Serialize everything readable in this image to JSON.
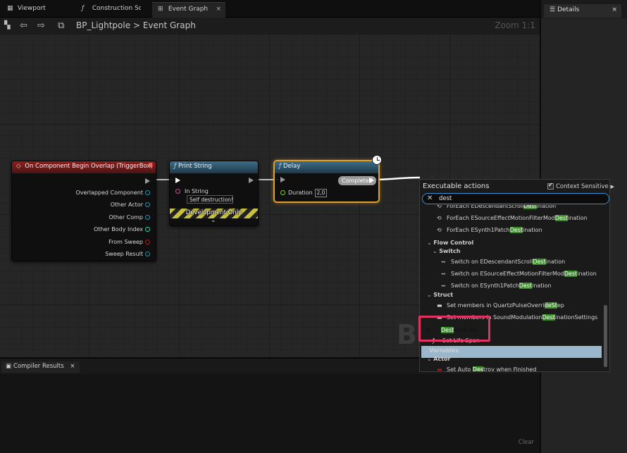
{
  "tabs": [
    {
      "label": "Viewport",
      "icon": "viewport-grid-icon"
    },
    {
      "label": "Construction Scri",
      "icon": "function-icon"
    },
    {
      "label": "Event Graph",
      "icon": "event-graph-icon",
      "close": "×"
    }
  ],
  "toolbar": {
    "blueprint_name": "BP_Lightpole",
    "separator": ">",
    "graph_name": "Event Graph",
    "zoom": "Zoom 1:1"
  },
  "graph": {
    "watermark": "BL",
    "nodes": {
      "begin_overlap": {
        "title": "On Component Begin Overlap (TriggerBox)",
        "pins": [
          "Overlapped Component",
          "Other Actor",
          "Other Comp",
          "Other Body Index",
          "From Sweep",
          "Sweep Result"
        ]
      },
      "print_string": {
        "title": "Print String",
        "in_string_label": "In String",
        "in_string_value": "Self destruction!!",
        "dev_only": "Development Only",
        "expand": "⌄"
      },
      "delay": {
        "title": "Delay",
        "completed": "Completed",
        "duration_label": "Duration",
        "duration_value": "2,0"
      }
    }
  },
  "context_menu": {
    "title": "Executable actions",
    "context_sensitive_label": "Context Sensitive",
    "context_sensitive_checked": true,
    "search_value": "dest",
    "items": [
      {
        "type": "action",
        "icon": "loop-icon",
        "pre": "ForEach EDescendantScroll",
        "hl": "Dest",
        "post": "ination"
      },
      {
        "type": "action",
        "icon": "loop-icon",
        "pre": "ForEach ESourceEffectMotionFilterMod",
        "hl": "Dest",
        "post": "ination"
      },
      {
        "type": "action",
        "icon": "loop-icon",
        "pre": "ForEach ESynth1Patch",
        "hl": "Dest",
        "post": "ination"
      },
      {
        "type": "category",
        "label": "Flow Control"
      },
      {
        "type": "category",
        "label": "Switch"
      },
      {
        "type": "action",
        "icon": "switch-icon",
        "pre": "Switch on EDescendantScroll",
        "hl": "Dest",
        "post": "ination"
      },
      {
        "type": "action",
        "icon": "switch-icon",
        "pre": "Switch on ESourceEffectMotionFilterMod",
        "hl": "Dest",
        "post": "ination"
      },
      {
        "type": "action",
        "icon": "switch-icon",
        "pre": "Switch on ESynth1Patch",
        "hl": "Dest",
        "post": "ination"
      },
      {
        "type": "category",
        "label": "Struct"
      },
      {
        "type": "action",
        "icon": "struct-icon",
        "pre": "Set members in QuartzPulseOverri",
        "hl": "deSt",
        "post": "ep"
      },
      {
        "type": "action",
        "icon": "struct-icon",
        "pre": "Set members in SoundModulation",
        "hl": "Dest",
        "post": "inationSettings"
      },
      {
        "type": "action",
        "icon": "star-icon",
        "pre": "",
        "hl": "Dest",
        "post": "royActor",
        "selected": true
      },
      {
        "type": "action",
        "icon": "function-icon",
        "pre": "Set Life Span",
        "hl": "",
        "post": ""
      },
      {
        "type": "category",
        "label": "Variables"
      },
      {
        "type": "category",
        "label": "Actor"
      },
      {
        "type": "action",
        "icon": "variable-icon",
        "pre": "Set Auto ",
        "hl": "Des",
        "post": "troy when Finished"
      }
    ]
  },
  "details": {
    "title": "Details",
    "close": "×"
  },
  "compiler": {
    "title": "Compiler Results",
    "close": "×",
    "clear": "Clear"
  },
  "colors": {
    "accent_blue": "#3b8fd3",
    "highlight_green": "#3d8c2c",
    "selection": "#9ab7cc",
    "callout": "#e23262",
    "delay_border": "#e0a02a"
  }
}
